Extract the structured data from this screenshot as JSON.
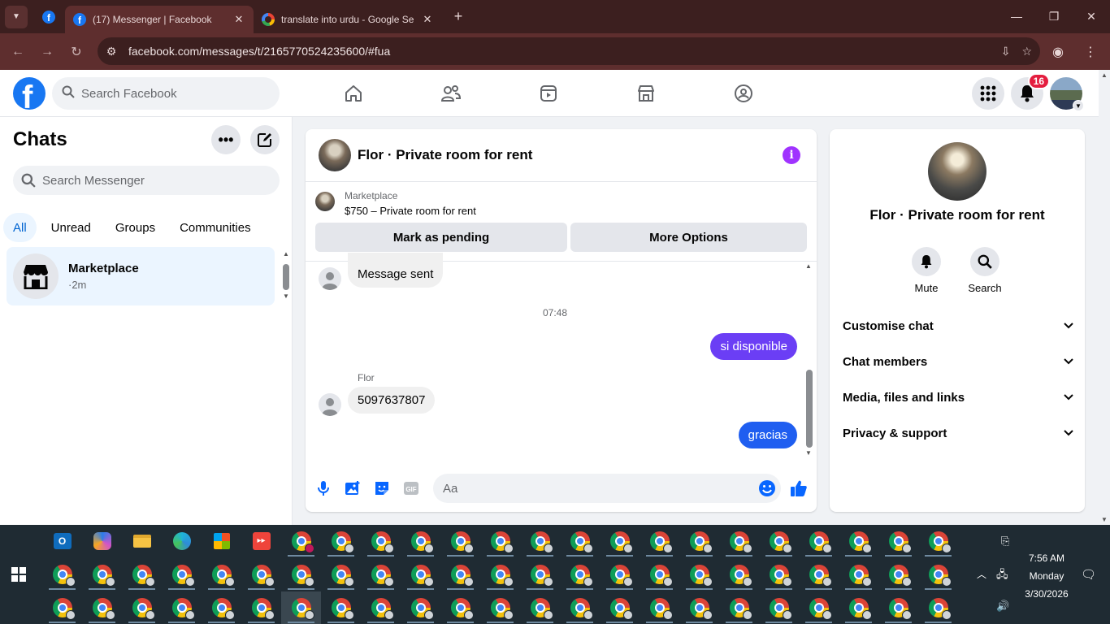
{
  "browser": {
    "tabs": [
      {
        "title": "(17) Messenger | Facebook",
        "icon": "facebook-icon",
        "active": true
      },
      {
        "title": "translate into urdu - Google Se",
        "icon": "google-icon",
        "active": false
      }
    ],
    "url": "facebook.com/messages/t/2165770524235600/#fua",
    "theme_color": "#5e2e2e"
  },
  "fb_header": {
    "search_placeholder": "Search Facebook",
    "notification_count": "16"
  },
  "sidebar": {
    "title": "Chats",
    "search_placeholder": "Search Messenger",
    "filters": [
      "All",
      "Unread",
      "Groups",
      "Communities"
    ],
    "active_filter": "All",
    "chats": [
      {
        "name": "Marketplace",
        "time": "·2m"
      }
    ]
  },
  "conversation": {
    "title": "Flor · Private room for rent",
    "marketplace": {
      "label": "Marketplace",
      "listing": "$750 – Private room for rent",
      "pending_button": "Mark as pending",
      "options_button": "More Options"
    },
    "messages": [
      {
        "from": "them",
        "text": "Message sent"
      },
      {
        "type": "timestamp",
        "text": "07:48"
      },
      {
        "from": "me",
        "text": "si disponible",
        "color": "#6b3ef5"
      },
      {
        "from": "them",
        "sender": "Flor",
        "text": "5097637807"
      },
      {
        "from": "me",
        "text": "gracias",
        "color": "#1f5ef0"
      }
    ],
    "composer_placeholder": "Aa"
  },
  "info_pane": {
    "name": "Flor · Private room for rent",
    "actions": [
      {
        "label": "Mute",
        "icon": "bell-icon"
      },
      {
        "label": "Search",
        "icon": "search-icon"
      }
    ],
    "sections": [
      "Customise chat",
      "Chat members",
      "Media, files and links",
      "Privacy & support"
    ]
  },
  "taskbar": {
    "time": "7:56 AM",
    "day": "Monday",
    "date": "3/30/2026"
  }
}
